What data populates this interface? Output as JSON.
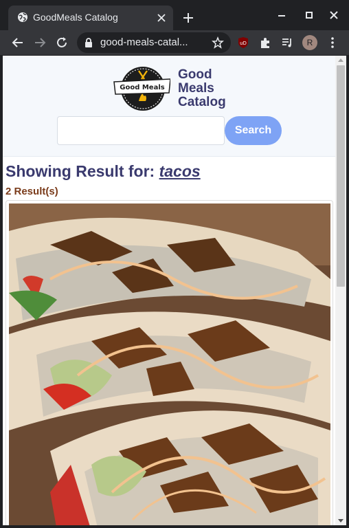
{
  "browser": {
    "tab_title": "GoodMeals Catalog",
    "url": "good-meals-catal...",
    "avatar_letter": "R",
    "ublock_label": "uD"
  },
  "page": {
    "brand_line1": "Good",
    "brand_line2": "Meals",
    "brand_line3": "Catalog",
    "logo_text": "Good Meals",
    "search_value": "",
    "search_button": "Search",
    "results_prefix": "Showing Result for: ",
    "query": "tacos",
    "results_count": "2 Result(s)"
  },
  "colors": {
    "brand": "#3a3a6e",
    "accent": "#7ea3f5",
    "count": "#7a3b1a"
  }
}
